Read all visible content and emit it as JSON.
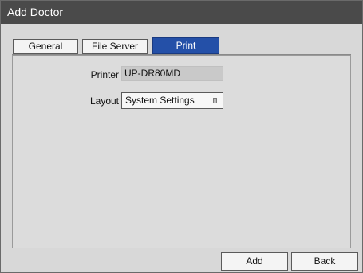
{
  "window": {
    "title": "Add Doctor"
  },
  "tabs": [
    {
      "label": "General",
      "active": false
    },
    {
      "label": "File Server",
      "active": false
    },
    {
      "label": "Print",
      "active": true
    }
  ],
  "print": {
    "printer_label": "Printer",
    "printer_value": "UP-DR80MD",
    "layout_label": "Layout",
    "layout_value": "System Settings"
  },
  "buttons": {
    "add_label": "Add",
    "back_label": "Back"
  },
  "colors": {
    "titlebar": "#4a4a4a",
    "active_tab": "#2450a8",
    "panel": "#dcdcdc",
    "window": "#d8d8d8"
  }
}
